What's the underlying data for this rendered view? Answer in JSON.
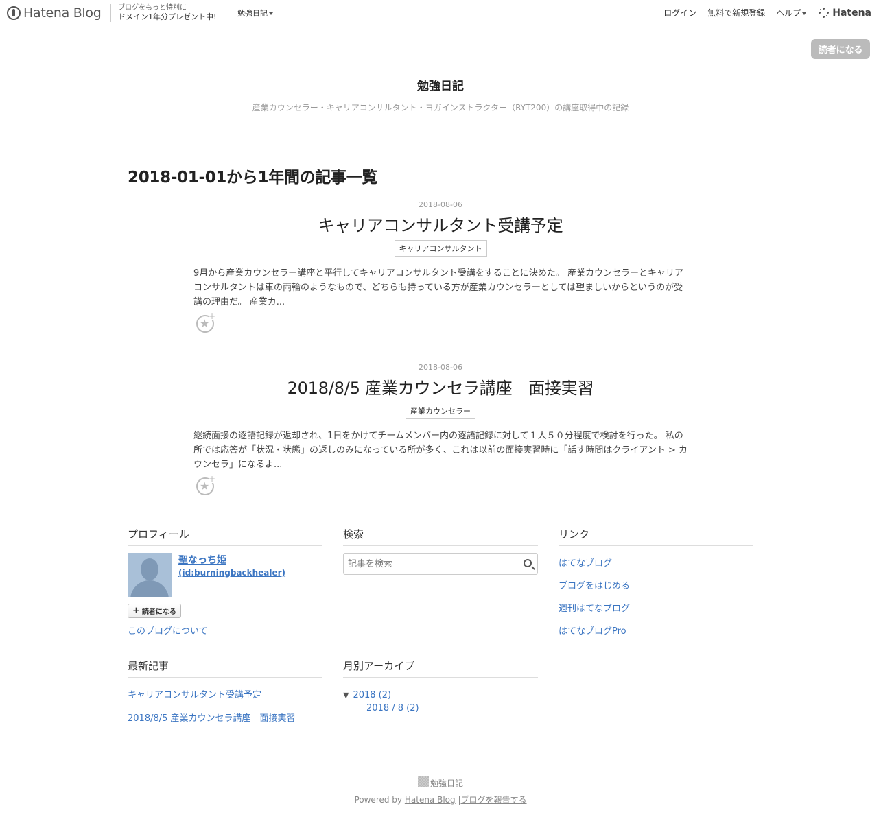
{
  "topbar": {
    "logo_text": "Hatena Blog",
    "promo_line1": "ブログをもっと特別に",
    "promo_line2": "ドメイン1年分プレゼント中!",
    "blog_menu": "勉強日記",
    "login": "ログイン",
    "signup": "無料で新規登録",
    "help": "ヘルプ",
    "brand": "Hatena"
  },
  "follow_button": "読者になる",
  "header": {
    "title": "勉強日記",
    "description": "産業カウンセラー・キャリアコンサルタント・ヨガインストラクター（RYT200）の講座取得中の記録"
  },
  "archive_heading": "2018-01-01から1年間の記事一覧",
  "entries": [
    {
      "date": "2018-08-06",
      "title": "キャリアコンサルタント受講予定",
      "category": "キャリアコンサルタント",
      "summary": "9月から産業カウンセラー講座と平行してキャリアコンサルタント受講をすることに決めた。 産業カウンセラーとキャリアコンサルタントは車の両輪のようなもので、どちらも持っている方が産業カウンセラーとしては望ましいからというのが受講の理由だ。 産業カ..."
    },
    {
      "date": "2018-08-06",
      "title": "2018/8/5 産業カウンセラ講座　面接実習",
      "category": "産業カウンセラー",
      "summary": "継続面接の逐語記録が返却され、1日をかけてチームメンバー内の逐語記録に対して１人５０分程度で検討を行った。 私の所では応答が「状況・状態」の返しのみになっている所が多く、これは以前の面接実習時に「話す時間はクライアント > カウンセラ」になるよ..."
    }
  ],
  "profile": {
    "title": "プロフィール",
    "name": "聖なっち姫",
    "id": "(id:burningbackhealer)",
    "subscribe": "読者になる",
    "about": "このブログについて"
  },
  "search": {
    "title": "検索",
    "placeholder": "記事を検索"
  },
  "links": {
    "title": "リンク",
    "items": [
      "はてなブログ",
      "ブログをはじめる",
      "週刊はてなブログ",
      "はてなブログPro"
    ]
  },
  "recent": {
    "title": "最新記事",
    "items": [
      "キャリアコンサルタント受講予定",
      "2018/8/5 産業カウンセラ講座　面接実習"
    ]
  },
  "archive": {
    "title": "月別アーカイブ",
    "year_toggle": "▼",
    "year": "2018 (2)",
    "month": "2018 / 8 (2)"
  },
  "footer": {
    "blog_name": "勉強日記",
    "powered_prefix": "Powered by",
    "powered_link": "Hatena Blog",
    "separator": "|",
    "report": "ブログを報告する"
  }
}
